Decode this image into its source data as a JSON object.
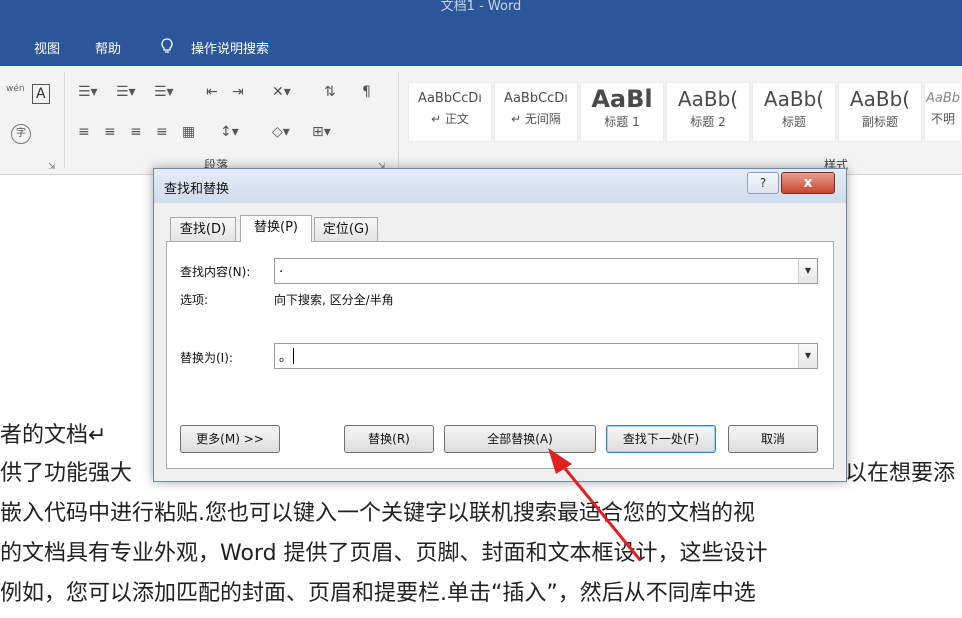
{
  "window": {
    "title": "文档1  -  Word"
  },
  "menubar": {
    "items": [
      "视图",
      "帮助",
      "操作说明搜索"
    ]
  },
  "ribbon": {
    "font_group": {
      "phonetic": "wén",
      "char_border": "A",
      "enclose": "字"
    },
    "paragraph_group": {
      "label": "段落"
    },
    "styles_group": {
      "label": "样式",
      "tiles": [
        {
          "preview": "AaBbCcDı",
          "name": "↵ 正文"
        },
        {
          "preview": "AaBbCcDı",
          "name": "↵ 无间隔"
        },
        {
          "preview": "AaBl",
          "name": "标题 1"
        },
        {
          "preview": "AaBb(",
          "name": "标题 2"
        },
        {
          "preview": "AaBb(",
          "name": "标题"
        },
        {
          "preview": "AaBb(",
          "name": "副标题"
        },
        {
          "preview": "AaBb",
          "name": "不明"
        }
      ]
    }
  },
  "document": {
    "lines": [
      "者的文档↵",
      "供了功能强大",
      "嵌入代码中进行粘贴.您也可以键入一个关键字以联机搜索最适合您的文档的视",
      "的文档具有专业外观，Word 提供了页眉、页脚、封面和文本框设计，这些设计",
      "例如，您可以添加匹配的封面、页眉和提要栏.单击“插入”，然后从不同库中选"
    ],
    "line2_tail": "以在想要添"
  },
  "dialog": {
    "title": "查找和替换",
    "help": "?",
    "close": "x",
    "tabs": [
      "查找(D)",
      "替换(P)",
      "定位(G)"
    ],
    "find_label": "查找内容(N):",
    "find_value": ".",
    "options_label": "选项:",
    "options_value": "向下搜索, 区分全/半角",
    "replace_label": "替换为(I):",
    "replace_value": "。",
    "buttons": {
      "more": "更多(M) >>",
      "replace": "替换(R)",
      "replace_all": "全部替换(A)",
      "find_next": "查找下一处(F)",
      "cancel": "取消"
    }
  },
  "colors": {
    "ribbon_blue": "#2b579a",
    "arrow_red": "#e02020"
  }
}
